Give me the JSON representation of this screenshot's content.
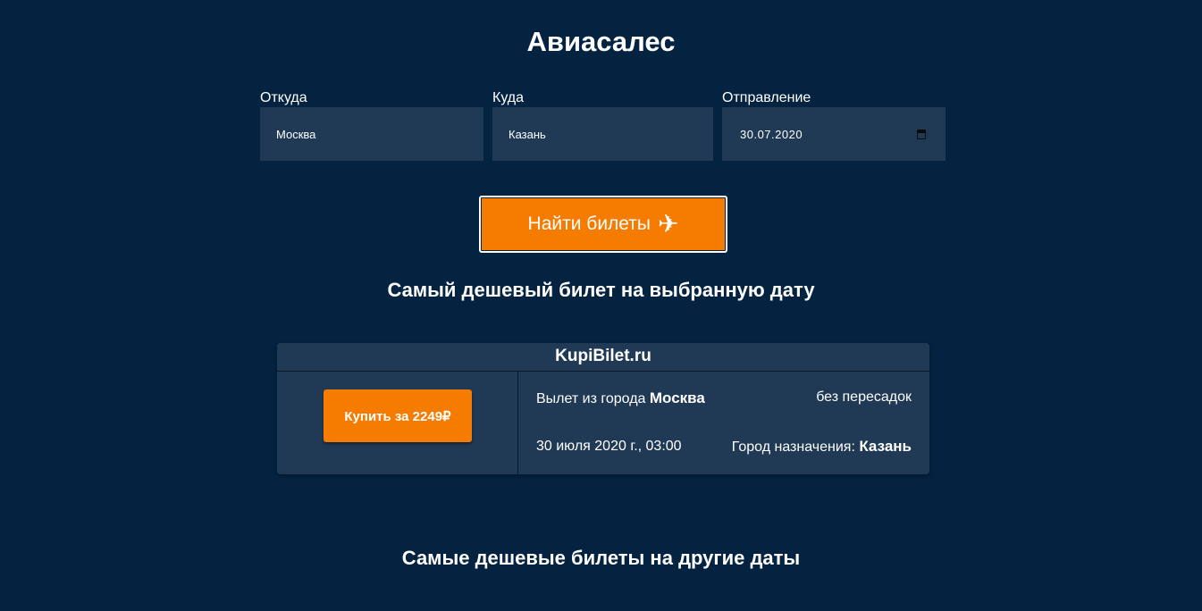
{
  "header": {
    "title": "Авиасалес"
  },
  "form": {
    "from_label": "Откуда",
    "from_value": "Москва",
    "to_label": "Куда",
    "to_value": "Казань",
    "date_label": "Отправление",
    "date_value": "30.07.2020",
    "date_icon": "calendar-icon",
    "search_label": "Найти билеты",
    "search_icon": "airplane-icon"
  },
  "cheapest": {
    "heading": "Самый дешевый билет на выбранную дату",
    "agency": "KupiBilet.ru",
    "buy_label": "Купить за 2249₽",
    "departure_prefix": "Вылет из города",
    "departure_city": "Москва",
    "transfers": "без пересадок",
    "datetime": "30 июля 2020 г., 03:00",
    "destination_prefix": "Город назначения:",
    "destination_city": "Казань"
  },
  "other": {
    "heading": "Самые дешевые билеты на другие даты"
  },
  "colors": {
    "background": "#042340",
    "panel": "#203a56",
    "accent": "#f57c00"
  }
}
